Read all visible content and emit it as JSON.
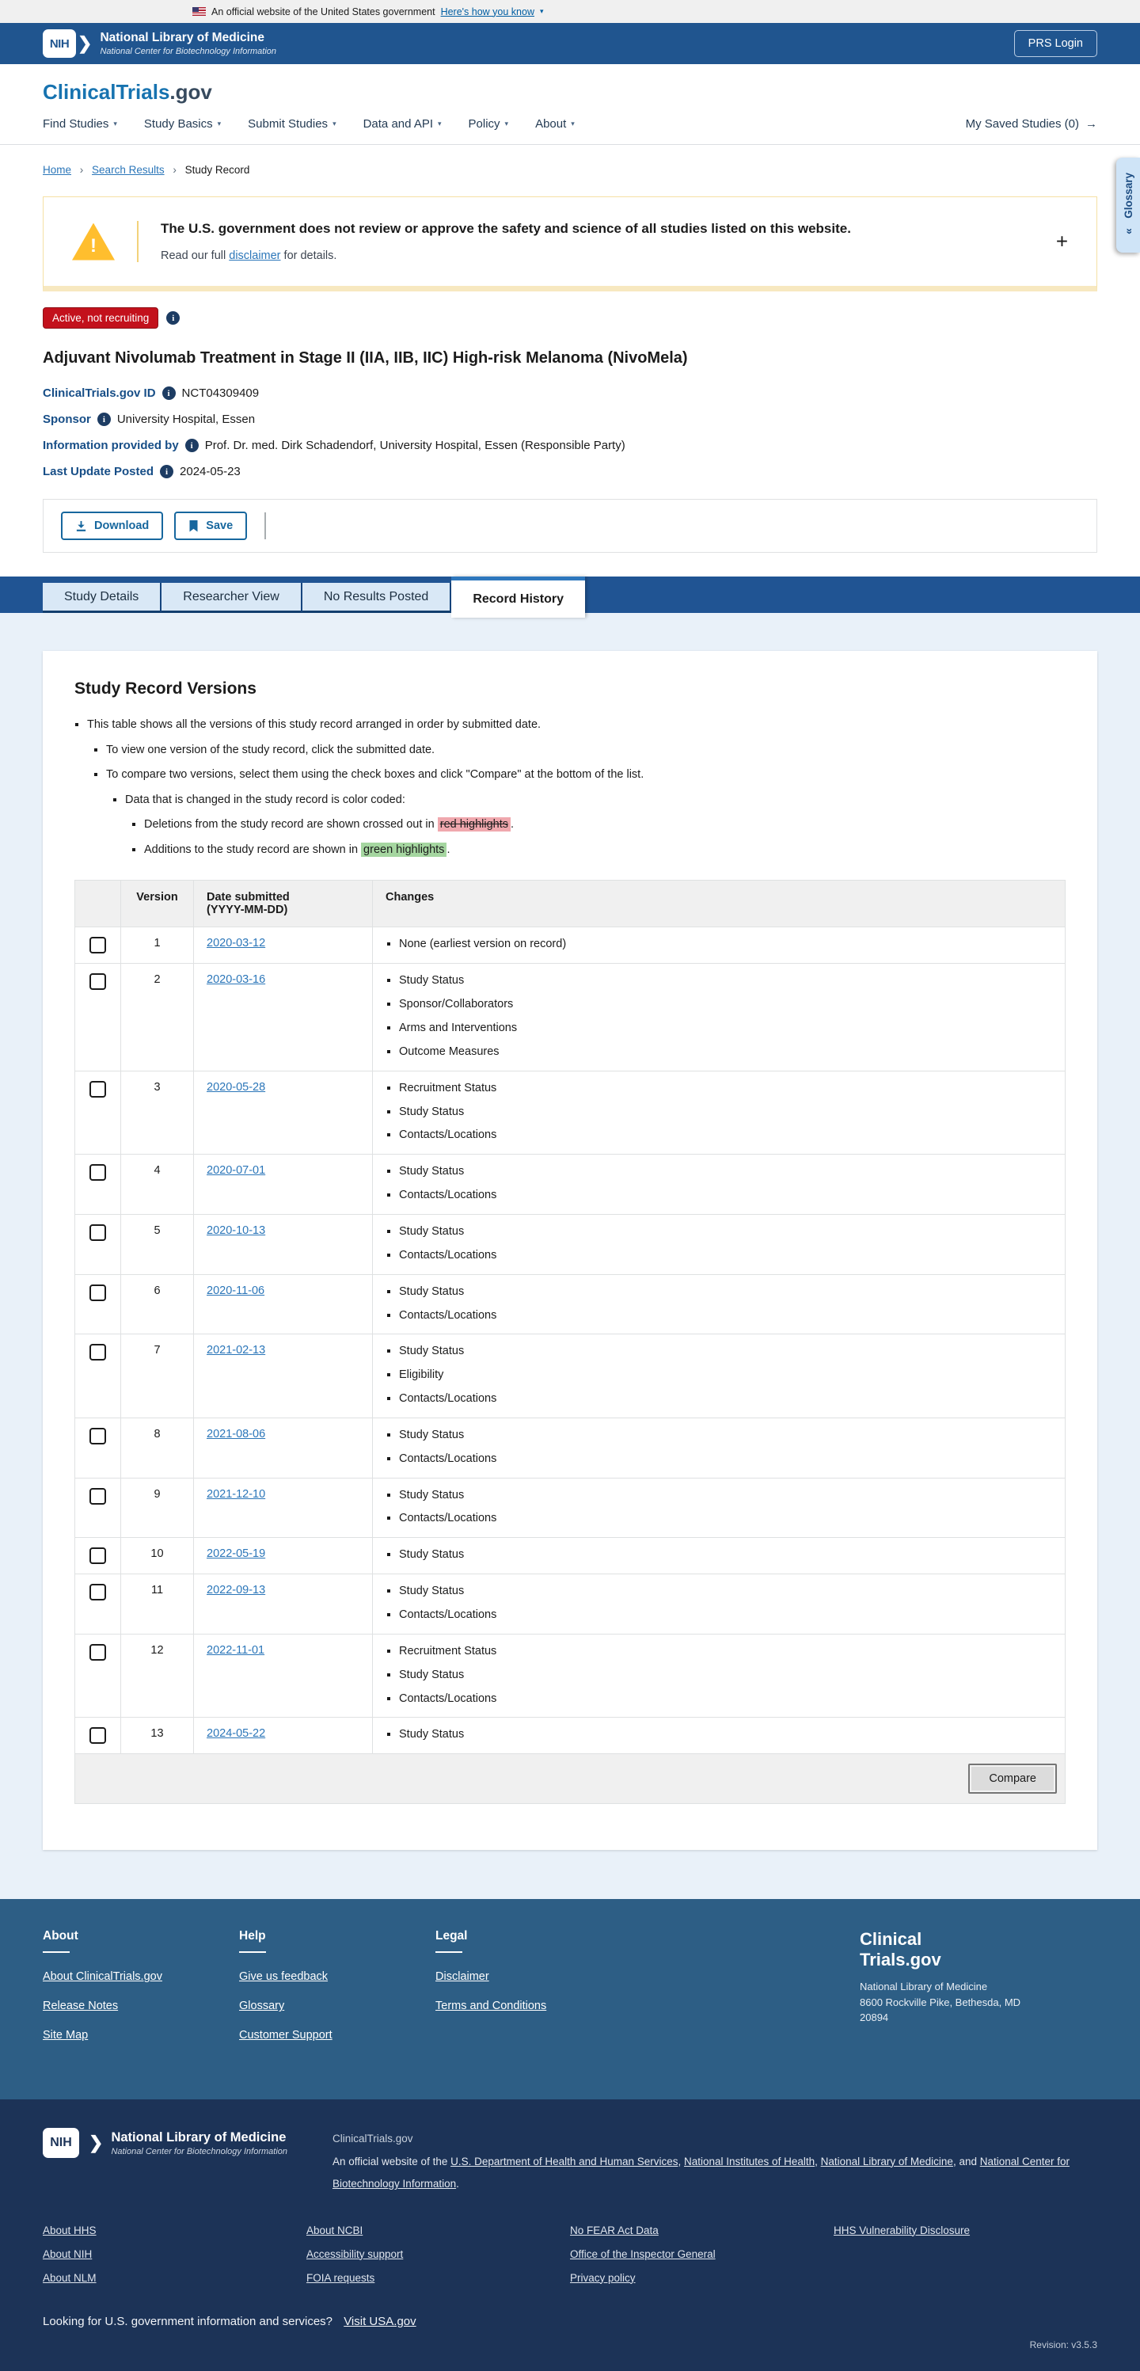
{
  "icons": {
    "chevron_down": "▾",
    "arrow_right": "→",
    "collapse_chevrons": "«",
    "plus": "+",
    "breadcrumb_sep": "›",
    "nih_chevron": "❯",
    "warning_bang": "!",
    "info_glyph": "i"
  },
  "colors": {
    "header_blue": "#20558f",
    "tab_strip_blue": "#205493",
    "footer_mid_blue": "#2d5e85",
    "footer_dark_navy": "#1c3357",
    "status_red": "#c3111c",
    "warning_amber": "#ffbe2e",
    "link_blue": "#2b76b9",
    "red_highlight": "#f0a8ae",
    "green_highlight": "#a5d6a0",
    "section_light_blue": "#e9f1f9"
  },
  "banner": {
    "text": "An official website of the United States government",
    "link": "Here's how you know"
  },
  "header": {
    "nih_logo": "NIH",
    "nlm_title": "National Library of Medicine",
    "nlm_subtitle": "National Center for Biotechnology Information",
    "prs_login": "PRS Login"
  },
  "site": {
    "logo_main": "ClinicalTrials",
    "logo_suffix": ".gov"
  },
  "nav": {
    "items": [
      "Find Studies",
      "Study Basics",
      "Submit Studies",
      "Data and API",
      "Policy",
      "About"
    ],
    "saved_studies": "My Saved Studies (0)"
  },
  "breadcrumb": {
    "home": "Home",
    "search_results": "Search Results",
    "current": "Study Record"
  },
  "glossary_tab": {
    "label": "Glossary"
  },
  "warning": {
    "title": "The U.S. government does not review or approve the safety and science of all studies listed on this website.",
    "body_pre": "Read our full ",
    "body_link": "disclaimer",
    "body_post": " for details."
  },
  "study": {
    "status_badge": "Active, not recruiting",
    "title": "Adjuvant Nivolumab Treatment in Stage II (IIA, IIB, IIC) High-risk Melanoma (NivoMela)",
    "fields": [
      {
        "label": "ClinicalTrials.gov ID",
        "value": "NCT04309409"
      },
      {
        "label": "Sponsor",
        "value": "University Hospital, Essen"
      },
      {
        "label": "Information provided by",
        "value": "Prof. Dr. med. Dirk Schadendorf, University Hospital, Essen (Responsible Party)"
      },
      {
        "label": "Last Update Posted",
        "value": "2024-05-23"
      }
    ]
  },
  "actions": {
    "download": "Download",
    "save": "Save"
  },
  "tabs": [
    {
      "label": "Study Details",
      "active": false
    },
    {
      "label": "Researcher View",
      "active": false
    },
    {
      "label": "No Results Posted",
      "active": false
    },
    {
      "label": "Record History",
      "active": true
    }
  ],
  "versions": {
    "heading": "Study Record Versions",
    "notes": {
      "intro": "This table shows all the versions of this study record arranged in order by submitted date.",
      "view": "To view one version of the study record, click the submitted date.",
      "compare": "To compare two versions, select them using the check boxes and click \"Compare\" at the bottom of the list.",
      "color_coded": "Data that is changed in the study record is color coded:",
      "deletions_pre": "Deletions from the study record are shown crossed out in ",
      "deletions_hl": "red highlights",
      "deletions_post": ".",
      "additions_pre": "Additions to the study record are shown in ",
      "additions_hl": "green highlights",
      "additions_post": "."
    },
    "table": {
      "headers": {
        "version": "Version",
        "date_l1": "Date submitted",
        "date_l2": "(YYYY-MM-DD)",
        "changes": "Changes"
      },
      "rows": [
        {
          "version": "1",
          "date": "2020-03-12",
          "changes": [
            "None (earliest version on record)"
          ]
        },
        {
          "version": "2",
          "date": "2020-03-16",
          "changes": [
            "Study Status",
            "Sponsor/Collaborators",
            "Arms and Interventions",
            "Outcome Measures"
          ]
        },
        {
          "version": "3",
          "date": "2020-05-28",
          "changes": [
            "Recruitment Status",
            "Study Status",
            "Contacts/Locations"
          ]
        },
        {
          "version": "4",
          "date": "2020-07-01",
          "changes": [
            "Study Status",
            "Contacts/Locations"
          ]
        },
        {
          "version": "5",
          "date": "2020-10-13",
          "changes": [
            "Study Status",
            "Contacts/Locations"
          ]
        },
        {
          "version": "6",
          "date": "2020-11-06",
          "changes": [
            "Study Status",
            "Contacts/Locations"
          ]
        },
        {
          "version": "7",
          "date": "2021-02-13",
          "changes": [
            "Study Status",
            "Eligibility",
            "Contacts/Locations"
          ]
        },
        {
          "version": "8",
          "date": "2021-08-06",
          "changes": [
            "Study Status",
            "Contacts/Locations"
          ]
        },
        {
          "version": "9",
          "date": "2021-12-10",
          "changes": [
            "Study Status",
            "Contacts/Locations"
          ]
        },
        {
          "version": "10",
          "date": "2022-05-19",
          "changes": [
            "Study Status"
          ]
        },
        {
          "version": "11",
          "date": "2022-09-13",
          "changes": [
            "Study Status",
            "Contacts/Locations"
          ]
        },
        {
          "version": "12",
          "date": "2022-11-01",
          "changes": [
            "Recruitment Status",
            "Study Status",
            "Contacts/Locations"
          ]
        },
        {
          "version": "13",
          "date": "2024-05-22",
          "changes": [
            "Study Status"
          ]
        }
      ]
    },
    "compare_button": "Compare"
  },
  "footer_mid": {
    "columns": [
      {
        "heading": "About",
        "links": [
          "About ClinicalTrials.gov",
          "Release Notes",
          "Site Map"
        ]
      },
      {
        "heading": "Help",
        "links": [
          "Give us feedback",
          "Glossary",
          "Customer Support"
        ]
      },
      {
        "heading": "Legal",
        "links": [
          "Disclaimer",
          "Terms and Conditions"
        ]
      }
    ],
    "logo_line1": "Clinical",
    "logo_line2": "Trials.gov",
    "org": "National Library of Medicine",
    "address_l1": "8600 Rockville Pike, Bethesda, MD",
    "address_l2": "20894"
  },
  "footer_bottom": {
    "nih_logo": "NIH",
    "nlm_title": "National Library of Medicine",
    "nlm_subtitle": "National Center for Biotechnology Information",
    "site": "ClinicalTrials.gov",
    "official_pre": "An official website of the ",
    "link_hhs": "U.S. Department of Health and Human Services",
    "sep1": ", ",
    "link_nih": "National Institutes of Health",
    "sep2": ", ",
    "link_nlm": "National Library of Medicine",
    "sep3": ", and ",
    "link_ncbi": "National Center for Biotechnology Information",
    "official_post": ".",
    "link_columns": [
      [
        "About HHS",
        "About NIH",
        "About NLM"
      ],
      [
        "About NCBI",
        "Accessibility support",
        "FOIA requests"
      ],
      [
        "No FEAR Act Data",
        "Office of the Inspector General",
        "Privacy policy"
      ],
      [
        "HHS Vulnerability Disclosure"
      ]
    ],
    "usa_pre": "Looking for U.S. government information and services?",
    "usa_link": "Visit USA.gov",
    "revision": "Revision: v3.5.3"
  }
}
